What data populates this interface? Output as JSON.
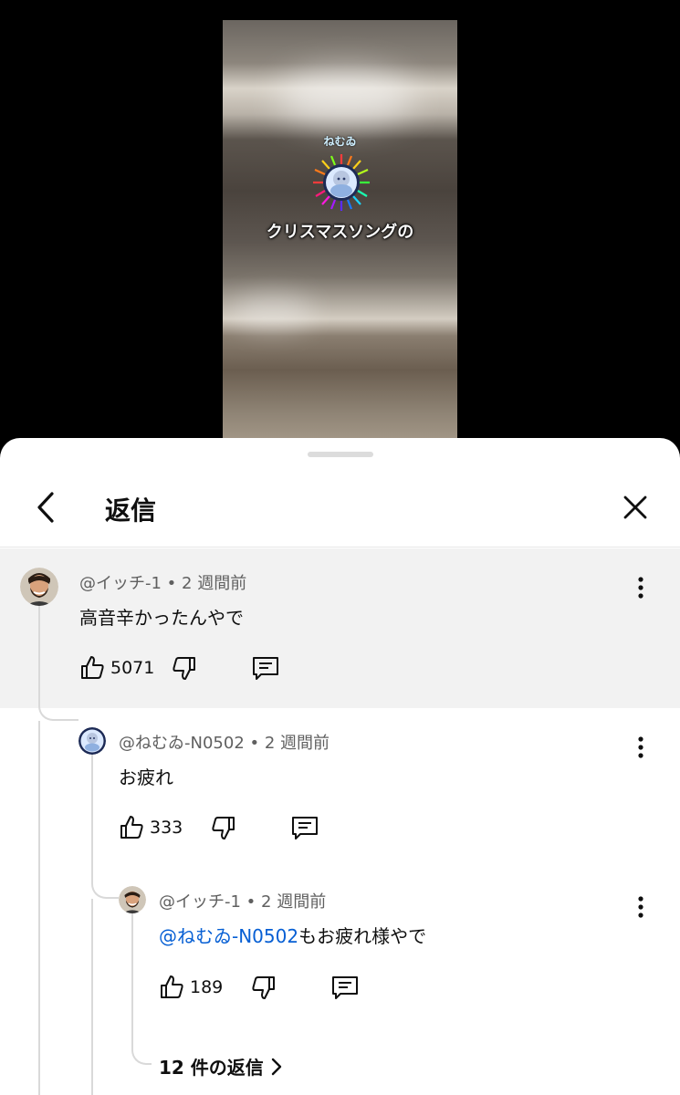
{
  "video": {
    "channel_name": "ねむゐ",
    "caption": "クリスマスソングの"
  },
  "panel": {
    "title": "返信"
  },
  "comments": [
    {
      "author": "@イッチ-1",
      "age": "2 週間前",
      "text": "高音辛かったんやで",
      "likes": "5071"
    },
    {
      "author": "@ねむゐ-N0502",
      "age": "2 週間前",
      "text": "お疲れ",
      "likes": "333"
    },
    {
      "author": "@イッチ-1",
      "age": "2 週間前",
      "mention": "@ねむゐ-N0502",
      "text": "もお疲れ様やで",
      "likes": "189"
    }
  ],
  "more_replies": {
    "label": "12 件の返信"
  },
  "colors": {
    "mention": "#065fd4",
    "highlight": "#f2f2f2"
  }
}
